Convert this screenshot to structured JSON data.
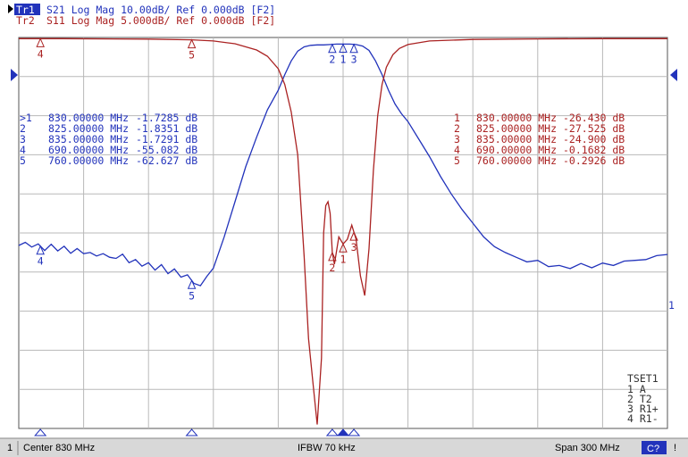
{
  "header": {
    "trace1": {
      "tag": "Tr1",
      "text": "S21 Log Mag 10.00dB/ Ref 0.000dB [F2]"
    },
    "trace2": {
      "tag": "Tr2",
      "text": "S11 Log Mag 5.000dB/ Ref 0.000dB [F2]"
    }
  },
  "colors": {
    "tr1": "#2233bb",
    "tr2": "#aa2222",
    "grid": "#b8b8b8",
    "status_bg": "#d8d8d8"
  },
  "marker_tables": {
    "tr1": [
      {
        "id": ">1",
        "freq": "830.00000 MHz",
        "value": "-1.7285 dB"
      },
      {
        "id": "2",
        "freq": "825.00000 MHz",
        "value": "-1.8351 dB"
      },
      {
        "id": "3",
        "freq": "835.00000 MHz",
        "value": "-1.7291 dB"
      },
      {
        "id": "4",
        "freq": "690.00000 MHz",
        "value": "-55.082 dB"
      },
      {
        "id": "5",
        "freq": "760.00000 MHz",
        "value": "-62.627 dB"
      }
    ],
    "tr2": [
      {
        "id": "1",
        "freq": "830.00000 MHz",
        "value": "-26.430 dB"
      },
      {
        "id": "2",
        "freq": "825.00000 MHz",
        "value": "-27.525 dB"
      },
      {
        "id": "3",
        "freq": "835.00000 MHz",
        "value": "-24.900 dB"
      },
      {
        "id": "4",
        "freq": "690.00000 MHz",
        "value": "-0.1682 dB"
      },
      {
        "id": "5",
        "freq": "760.00000 MHz",
        "value": "-0.2926 dB"
      }
    ]
  },
  "channel_info": {
    "title": "TSET1",
    "lines": [
      "1 A",
      "2 T2",
      "3 R1+",
      "4 R1-"
    ]
  },
  "status_bar": {
    "channel": "1",
    "center": "Center 830 MHz",
    "ifbw": "IFBW 70 kHz",
    "span": "Span 300 MHz",
    "badge": "C?",
    "end": "!"
  },
  "chart_data": {
    "type": "line",
    "x_unit": "MHz",
    "xlim": [
      680,
      980
    ],
    "series": [
      {
        "name": "Tr1 S21",
        "ylim": [
          -100,
          0
        ],
        "ref_level": 0,
        "x": [
          680,
          683,
          686,
          689,
          692,
          695,
          698,
          701,
          704,
          707,
          710,
          713,
          716,
          719,
          722,
          725,
          728,
          731,
          734,
          737,
          740,
          743,
          746,
          749,
          752,
          755,
          758,
          761,
          764,
          767,
          770,
          775,
          780,
          785,
          790,
          795,
          800,
          803,
          806,
          809,
          812,
          815,
          818,
          821,
          824,
          827,
          830,
          833,
          836,
          839,
          842,
          845,
          848,
          851,
          854,
          857,
          860,
          865,
          870,
          875,
          880,
          885,
          890,
          895,
          900,
          905,
          910,
          915,
          920,
          925,
          930,
          935,
          940,
          945,
          950,
          955,
          960,
          965,
          970,
          975,
          980
        ],
        "y": [
          -53.2,
          -52.4,
          -53.6,
          -52.8,
          -54.5,
          -52.9,
          -54.6,
          -53.4,
          -55.2,
          -54.0,
          -55.3,
          -55.0,
          -55.9,
          -55.3,
          -56.2,
          -56.5,
          -55.4,
          -57.6,
          -56.8,
          -58.5,
          -57.6,
          -59.5,
          -58.1,
          -60.4,
          -59.2,
          -61.3,
          -60.7,
          -62.9,
          -63.5,
          -61.1,
          -59.0,
          -51.0,
          -42.0,
          -33.0,
          -25.5,
          -18.5,
          -13.5,
          -9.5,
          -6.0,
          -3.5,
          -2.4,
          -2.0,
          -1.9,
          -1.9,
          -1.8,
          -1.7,
          -1.7,
          -1.7,
          -1.8,
          -2.2,
          -3.3,
          -6.0,
          -9.5,
          -13.5,
          -17.0,
          -19.5,
          -21.5,
          -26.0,
          -30.5,
          -35.5,
          -40.0,
          -44.0,
          -47.5,
          -51.0,
          -53.5,
          -55.0,
          -56.2,
          -57.4,
          -57.0,
          -58.6,
          -58.3,
          -59.1,
          -57.8,
          -58.9,
          -57.7,
          -58.3,
          -57.2,
          -57.0,
          -56.8,
          -55.8,
          -55.5
        ]
      },
      {
        "name": "Tr2 S11",
        "ylim": [
          -50,
          0
        ],
        "ref_level": 0,
        "x": [
          680,
          700,
          740,
          760,
          770,
          780,
          790,
          795,
          800,
          803,
          806,
          809,
          812,
          814,
          816,
          818,
          820,
          821,
          822,
          823,
          824,
          825,
          826,
          828,
          830,
          832,
          834,
          835,
          836,
          838,
          840,
          842,
          844,
          846,
          848,
          850,
          853,
          856,
          860,
          870,
          890,
          920,
          950,
          980
        ],
        "y": [
          -0.15,
          -0.15,
          -0.2,
          -0.3,
          -0.45,
          -0.8,
          -1.6,
          -2.4,
          -4.0,
          -6.0,
          -9.5,
          -15.0,
          -28.0,
          -38.5,
          -44.0,
          -49.5,
          -41.0,
          -25.0,
          -21.5,
          -21.0,
          -22.5,
          -27.5,
          -29.0,
          -25.5,
          -26.4,
          -25.8,
          -24.0,
          -24.9,
          -25.8,
          -30.5,
          -33.0,
          -27.0,
          -17.0,
          -10.0,
          -6.0,
          -3.8,
          -2.2,
          -1.4,
          -0.9,
          -0.45,
          -0.25,
          -0.18,
          -0.15,
          -0.15
        ]
      }
    ],
    "markers": {
      "tr1": [
        {
          "id": "1",
          "x": 830
        },
        {
          "id": "2",
          "x": 825
        },
        {
          "id": "3",
          "x": 835
        },
        {
          "id": "4",
          "x": 690
        },
        {
          "id": "5",
          "x": 760
        }
      ],
      "tr2": [
        {
          "id": "1",
          "x": 830
        },
        {
          "id": "2",
          "x": 825
        },
        {
          "id": "3",
          "x": 835
        },
        {
          "id": "4",
          "x": 690
        },
        {
          "id": "5",
          "x": 760
        }
      ]
    },
    "grid": true,
    "divisions": {
      "x": 10,
      "y": 10
    }
  }
}
